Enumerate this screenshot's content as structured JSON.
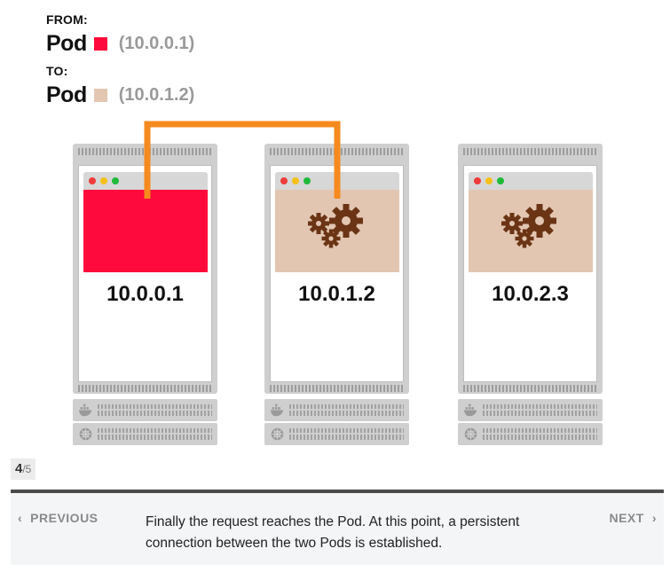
{
  "header": {
    "from_label": "FROM:",
    "from_pod": "Pod",
    "from_ip": "(10.0.0.1)",
    "to_label": "TO:",
    "to_pod": "Pod",
    "to_ip": "(10.0.1.2)"
  },
  "colors": {
    "source_pod": "#ff0a3c",
    "target_pod": "#e2c6b2",
    "connector": "#f68a1e",
    "gear": "#6b3415"
  },
  "servers": [
    {
      "ip": "10.0.0.1",
      "content": "solid-red"
    },
    {
      "ip": "10.0.1.2",
      "content": "gears"
    },
    {
      "ip": "10.0.2.3",
      "content": "gears"
    }
  ],
  "pager": {
    "current": "4",
    "total": "/5"
  },
  "footer": {
    "prev_label": "PREVIOUS",
    "next_label": "NEXT",
    "caption": "Finally the request reaches the Pod. At this point, a persistent connection between the two Pods is established."
  }
}
